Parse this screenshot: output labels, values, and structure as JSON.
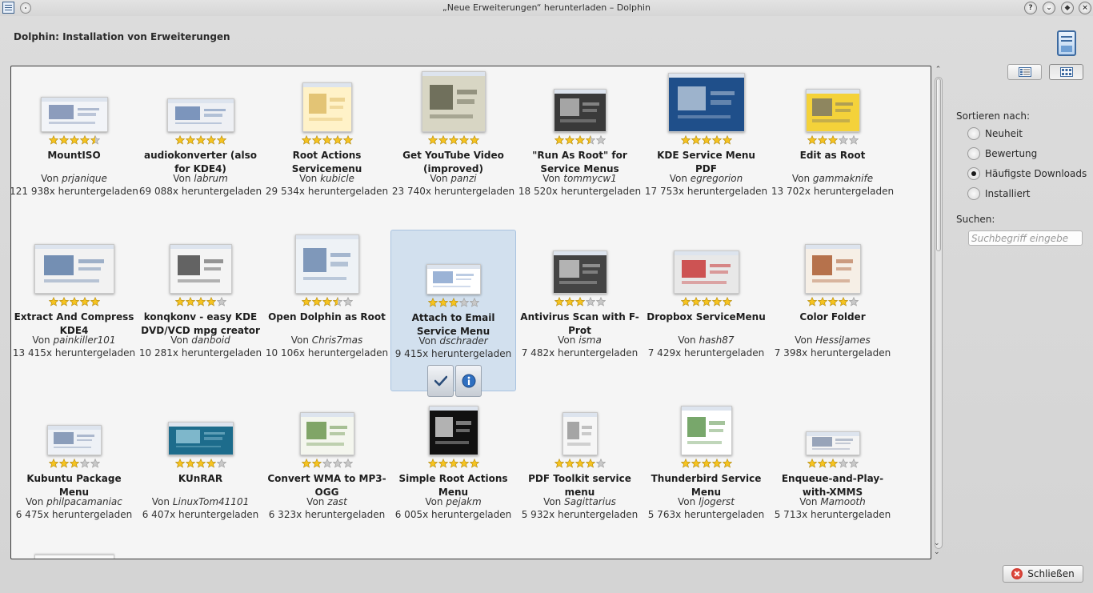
{
  "window": {
    "title": "„Neue Erweiterungen“ herunterladen – Dolphin"
  },
  "header": {
    "title": "Dolphin: Installation von Erweiterungen"
  },
  "labels": {
    "by_prefix": "Von ",
    "downloads_suffix": "x heruntergeladen"
  },
  "items": [
    {
      "name": "MountISO",
      "author": "prjanique",
      "downloads": "121 938",
      "rating": 4.5
    },
    {
      "name": "audiokonverter (also for KDE4)",
      "author": "labrum",
      "downloads": "69 088",
      "rating": 5
    },
    {
      "name": "Root Actions Servicemenu",
      "author": "kubicle",
      "downloads": "29 534",
      "rating": 5
    },
    {
      "name": "Get YouTube Video (improved)",
      "author": "panzi",
      "downloads": "23 740",
      "rating": 5
    },
    {
      "name": "\"Run As Root\" for Service Menus",
      "author": "tommycw1",
      "downloads": "18 520",
      "rating": 3.5
    },
    {
      "name": "KDE Service Menu PDF",
      "author": "egregorion",
      "downloads": "17 753",
      "rating": 5
    },
    {
      "name": "Edit as Root",
      "author": "gammaknife",
      "downloads": "13 702",
      "rating": 3
    },
    {
      "name": "Extract And Compress KDE4",
      "author": "painkiller101",
      "downloads": "13 415",
      "rating": 5
    },
    {
      "name": "konqkonv - easy KDE DVD/VCD mpg creator",
      "author": "danboid",
      "downloads": "10 281",
      "rating": 4
    },
    {
      "name": "Open Dolphin as Root",
      "author": "Chris7mas",
      "downloads": "10 106",
      "rating": 3.5
    },
    {
      "name": "Attach to Email Service Menu",
      "author": "dschrader",
      "downloads": "9 415",
      "rating": 3
    },
    {
      "name": "Antivirus Scan with F-Prot",
      "author": "isma",
      "downloads": "7 482",
      "rating": 3
    },
    {
      "name": "Dropbox ServiceMenu",
      "author": "hash87",
      "downloads": "7 429",
      "rating": 5
    },
    {
      "name": "Color Folder",
      "author": "HessiJames",
      "downloads": "7 398",
      "rating": 4
    },
    {
      "name": "Kubuntu Package Menu",
      "author": "philpacamaniac",
      "downloads": "6 475",
      "rating": 3
    },
    {
      "name": "KUnRAR",
      "author": "LinuxTom41101",
      "downloads": "6 407",
      "rating": 4
    },
    {
      "name": "Convert WMA to MP3-OGG",
      "author": "zast",
      "downloads": "6 323",
      "rating": 2
    },
    {
      "name": "Simple Root Actions Menu",
      "author": "pejakm",
      "downloads": "6 005",
      "rating": 5
    },
    {
      "name": "PDF Toolkit service menu",
      "author": "Sagittarius",
      "downloads": "5 932",
      "rating": 4
    },
    {
      "name": "Thunderbird Service Menu",
      "author": "ljogerst",
      "downloads": "5 763",
      "rating": 5
    },
    {
      "name": "Enqueue-and-Play-with-XMMS",
      "author": "Mamooth",
      "downloads": "5 713",
      "rating": 3
    }
  ],
  "selected_item": "Attach to Email Service Menu",
  "hover_actions": {
    "install": "check-icon",
    "details": "info-icon"
  },
  "sidebar": {
    "sort_label": "Sortieren nach:",
    "sort_options": [
      {
        "label": "Neuheit",
        "checked": false
      },
      {
        "label": "Bewertung",
        "checked": false
      },
      {
        "label": "Häufigste Downloads",
        "checked": true
      },
      {
        "label": "Installiert",
        "checked": false
      }
    ],
    "search_label": "Suchen:",
    "search_placeholder": "Suchbegriff eingebe",
    "search_value": ""
  },
  "footer": {
    "close_label": "Schließen"
  },
  "colors": {
    "star_full": "#f6c31f",
    "star_empty": "#c8c8c8",
    "selection": "#b4cde8"
  }
}
